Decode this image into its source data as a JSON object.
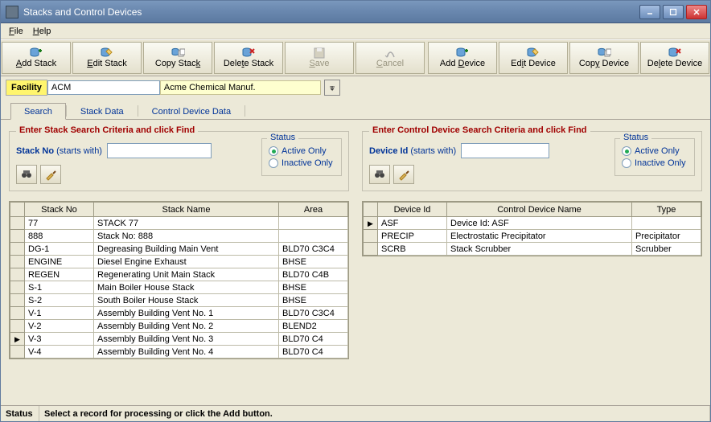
{
  "window": {
    "title": "Stacks and Control Devices"
  },
  "menu": {
    "file_label": "File",
    "help_label": "Help"
  },
  "toolbar_btns": {
    "add_stack": "Add Stack",
    "edit_stack": "Edit Stack",
    "copy_stack": "Copy Stack",
    "delete_stack": "Delete Stack",
    "save": "Save",
    "cancel": "Cancel",
    "add_device": "Add Device",
    "edit_device": "Edit  Device",
    "copy_device": "Copy Device",
    "delete_device": "Delete Device"
  },
  "facility": {
    "label": "Facility",
    "code": "ACM",
    "name": "Acme Chemical Manuf."
  },
  "tabs": {
    "search": "Search",
    "stack_data": "Stack Data",
    "control_device_data": "Control Device Data"
  },
  "stack_search": {
    "legend": "Enter Stack Search Criteria and click Find",
    "label_bold": "Stack No",
    "label_rest": " (starts with)",
    "value": "",
    "status_legend": "Status",
    "active": "Active Only",
    "inactive": "Inactive Only"
  },
  "device_search": {
    "legend": "Enter Control Device Search Criteria and click Find",
    "label_bold": "Device Id",
    "label_rest": "  (starts with)",
    "value": "",
    "status_legend": "Status",
    "active": "Active Only",
    "inactive": "Inactive Only"
  },
  "stack_table": {
    "headers": {
      "no": "Stack No",
      "name": "Stack Name",
      "area": "Area"
    },
    "rows": [
      {
        "no": "77",
        "name": "STACK 77",
        "area": "",
        "sel": false
      },
      {
        "no": "888",
        "name": "Stack No: 888",
        "area": "",
        "sel": false
      },
      {
        "no": "DG-1",
        "name": "Degreasing Building Main Vent",
        "area": "BLD70 C3C4",
        "sel": false
      },
      {
        "no": "ENGINE",
        "name": "Diesel Engine Exhaust",
        "area": "BHSE",
        "sel": false
      },
      {
        "no": "REGEN",
        "name": "Regenerating Unit Main Stack",
        "area": "BLD70 C4B",
        "sel": false
      },
      {
        "no": "S-1",
        "name": "Main Boiler House Stack",
        "area": "BHSE",
        "sel": false
      },
      {
        "no": "S-2",
        "name": "South Boiler House Stack",
        "area": "BHSE",
        "sel": false
      },
      {
        "no": "V-1",
        "name": "Assembly Building Vent No. 1",
        "area": "BLD70 C3C4",
        "sel": false
      },
      {
        "no": "V-2",
        "name": "Assembly Building Vent No. 2",
        "area": "BLEND2",
        "sel": false
      },
      {
        "no": "V-3",
        "name": "Assembly Building Vent No. 3",
        "area": "BLD70 C4",
        "sel": true
      },
      {
        "no": "V-4",
        "name": "Assembly Building Vent No. 4",
        "area": "BLD70 C4",
        "sel": false
      }
    ]
  },
  "device_table": {
    "headers": {
      "id": "Device Id",
      "name": "Control Device Name",
      "type": "Type"
    },
    "rows": [
      {
        "id": "ASF",
        "name": "Device Id: ASF",
        "type": "",
        "sel": true
      },
      {
        "id": "PRECIP",
        "name": "Electrostatic Precipitator",
        "type": "Precipitator",
        "sel": false
      },
      {
        "id": "SCRB",
        "name": "Stack Scrubber",
        "type": "Scrubber",
        "sel": false
      }
    ]
  },
  "statusbar": {
    "label": "Status",
    "text": "Select a record for processing or click the Add button."
  }
}
